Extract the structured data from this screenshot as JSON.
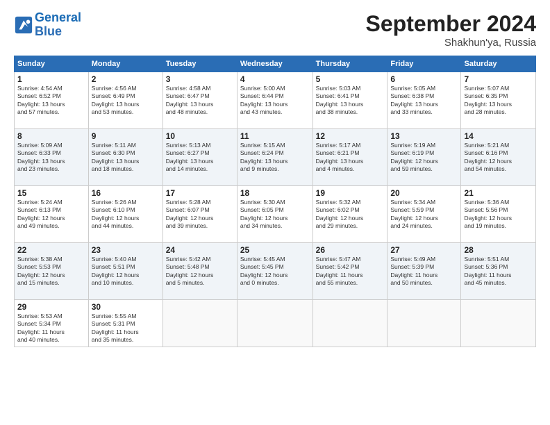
{
  "header": {
    "logo_line1": "General",
    "logo_line2": "Blue",
    "month": "September 2024",
    "location": "Shakhun'ya, Russia"
  },
  "weekdays": [
    "Sunday",
    "Monday",
    "Tuesday",
    "Wednesday",
    "Thursday",
    "Friday",
    "Saturday"
  ],
  "weeks": [
    [
      {
        "day": "1",
        "info": "Sunrise: 4:54 AM\nSunset: 6:52 PM\nDaylight: 13 hours\nand 57 minutes."
      },
      {
        "day": "2",
        "info": "Sunrise: 4:56 AM\nSunset: 6:49 PM\nDaylight: 13 hours\nand 53 minutes."
      },
      {
        "day": "3",
        "info": "Sunrise: 4:58 AM\nSunset: 6:47 PM\nDaylight: 13 hours\nand 48 minutes."
      },
      {
        "day": "4",
        "info": "Sunrise: 5:00 AM\nSunset: 6:44 PM\nDaylight: 13 hours\nand 43 minutes."
      },
      {
        "day": "5",
        "info": "Sunrise: 5:03 AM\nSunset: 6:41 PM\nDaylight: 13 hours\nand 38 minutes."
      },
      {
        "day": "6",
        "info": "Sunrise: 5:05 AM\nSunset: 6:38 PM\nDaylight: 13 hours\nand 33 minutes."
      },
      {
        "day": "7",
        "info": "Sunrise: 5:07 AM\nSunset: 6:35 PM\nDaylight: 13 hours\nand 28 minutes."
      }
    ],
    [
      {
        "day": "8",
        "info": "Sunrise: 5:09 AM\nSunset: 6:33 PM\nDaylight: 13 hours\nand 23 minutes."
      },
      {
        "day": "9",
        "info": "Sunrise: 5:11 AM\nSunset: 6:30 PM\nDaylight: 13 hours\nand 18 minutes."
      },
      {
        "day": "10",
        "info": "Sunrise: 5:13 AM\nSunset: 6:27 PM\nDaylight: 13 hours\nand 14 minutes."
      },
      {
        "day": "11",
        "info": "Sunrise: 5:15 AM\nSunset: 6:24 PM\nDaylight: 13 hours\nand 9 minutes."
      },
      {
        "day": "12",
        "info": "Sunrise: 5:17 AM\nSunset: 6:21 PM\nDaylight: 13 hours\nand 4 minutes."
      },
      {
        "day": "13",
        "info": "Sunrise: 5:19 AM\nSunset: 6:19 PM\nDaylight: 12 hours\nand 59 minutes."
      },
      {
        "day": "14",
        "info": "Sunrise: 5:21 AM\nSunset: 6:16 PM\nDaylight: 12 hours\nand 54 minutes."
      }
    ],
    [
      {
        "day": "15",
        "info": "Sunrise: 5:24 AM\nSunset: 6:13 PM\nDaylight: 12 hours\nand 49 minutes."
      },
      {
        "day": "16",
        "info": "Sunrise: 5:26 AM\nSunset: 6:10 PM\nDaylight: 12 hours\nand 44 minutes."
      },
      {
        "day": "17",
        "info": "Sunrise: 5:28 AM\nSunset: 6:07 PM\nDaylight: 12 hours\nand 39 minutes."
      },
      {
        "day": "18",
        "info": "Sunrise: 5:30 AM\nSunset: 6:05 PM\nDaylight: 12 hours\nand 34 minutes."
      },
      {
        "day": "19",
        "info": "Sunrise: 5:32 AM\nSunset: 6:02 PM\nDaylight: 12 hours\nand 29 minutes."
      },
      {
        "day": "20",
        "info": "Sunrise: 5:34 AM\nSunset: 5:59 PM\nDaylight: 12 hours\nand 24 minutes."
      },
      {
        "day": "21",
        "info": "Sunrise: 5:36 AM\nSunset: 5:56 PM\nDaylight: 12 hours\nand 19 minutes."
      }
    ],
    [
      {
        "day": "22",
        "info": "Sunrise: 5:38 AM\nSunset: 5:53 PM\nDaylight: 12 hours\nand 15 minutes."
      },
      {
        "day": "23",
        "info": "Sunrise: 5:40 AM\nSunset: 5:51 PM\nDaylight: 12 hours\nand 10 minutes."
      },
      {
        "day": "24",
        "info": "Sunrise: 5:42 AM\nSunset: 5:48 PM\nDaylight: 12 hours\nand 5 minutes."
      },
      {
        "day": "25",
        "info": "Sunrise: 5:45 AM\nSunset: 5:45 PM\nDaylight: 12 hours\nand 0 minutes."
      },
      {
        "day": "26",
        "info": "Sunrise: 5:47 AM\nSunset: 5:42 PM\nDaylight: 11 hours\nand 55 minutes."
      },
      {
        "day": "27",
        "info": "Sunrise: 5:49 AM\nSunset: 5:39 PM\nDaylight: 11 hours\nand 50 minutes."
      },
      {
        "day": "28",
        "info": "Sunrise: 5:51 AM\nSunset: 5:36 PM\nDaylight: 11 hours\nand 45 minutes."
      }
    ],
    [
      {
        "day": "29",
        "info": "Sunrise: 5:53 AM\nSunset: 5:34 PM\nDaylight: 11 hours\nand 40 minutes."
      },
      {
        "day": "30",
        "info": "Sunrise: 5:55 AM\nSunset: 5:31 PM\nDaylight: 11 hours\nand 35 minutes."
      },
      null,
      null,
      null,
      null,
      null
    ]
  ]
}
